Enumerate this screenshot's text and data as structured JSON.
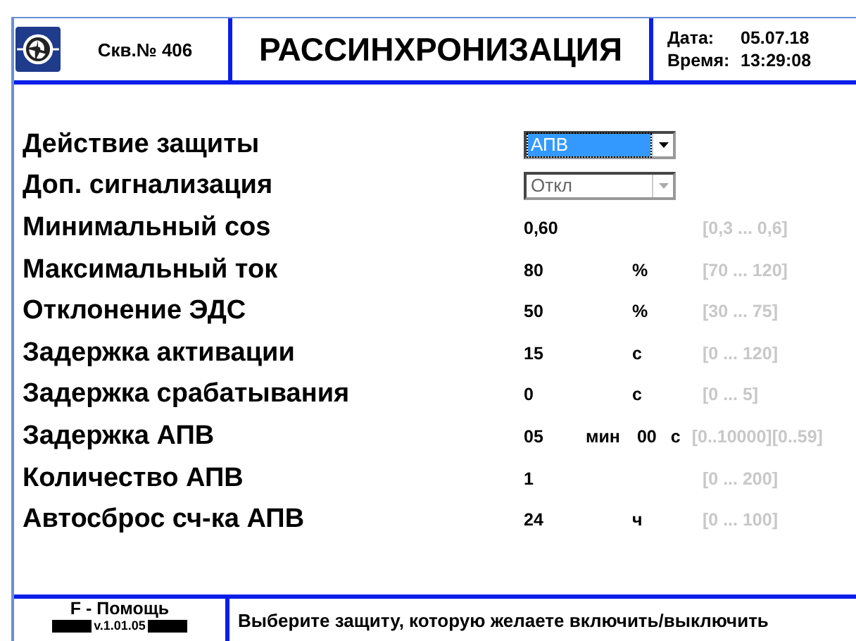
{
  "header": {
    "well": "Скв.№ 406",
    "title": "РАССИНХРОНИЗАЦИЯ",
    "date_label": "Дата:",
    "date": "05.07.18",
    "time_label": "Время:",
    "time": "13:29:08"
  },
  "rows": [
    {
      "kind": "dropdown",
      "label": "Действие защиты",
      "value": "АПВ",
      "selected": true,
      "disabled": false
    },
    {
      "kind": "dropdown",
      "label": "Доп. сигнализация",
      "value": "Откл",
      "selected": false,
      "disabled": true
    },
    {
      "kind": "value",
      "label": "Минимальный cos",
      "value": "0,60",
      "range": "[0,3 ... 0,6]"
    },
    {
      "kind": "value",
      "label": "Максимальный ток",
      "value": "80",
      "unit": "%",
      "range": "[70 ... 120]"
    },
    {
      "kind": "value",
      "label": "Отклонение ЭДС",
      "value": "50",
      "unit": "%",
      "range": "[30 ... 75]"
    },
    {
      "kind": "value",
      "label": "Задержка активации",
      "value": "15",
      "unit": "с",
      "range": "[0 ... 120]"
    },
    {
      "kind": "value",
      "label": "Задержка срабатывания",
      "value": "0",
      "unit": "с",
      "range": "[0 ... 5]"
    },
    {
      "kind": "double",
      "label": "Задержка АПВ",
      "value": "05",
      "unit": "мин",
      "value2": "00",
      "unit2": "с",
      "range": "[0..10000][0..59]"
    },
    {
      "kind": "value",
      "label": "Количество АПВ",
      "value": "1",
      "range": "[0 ... 200]"
    },
    {
      "kind": "value",
      "label": "Автосброс сч-ка АПВ",
      "value": "24",
      "unit": "ч",
      "range": "[0 ... 100]"
    }
  ],
  "footer": {
    "help": "F - Помощь",
    "version": "v.1.01.05",
    "message": "Выберите защиту, которую желаете включить/выключить"
  }
}
